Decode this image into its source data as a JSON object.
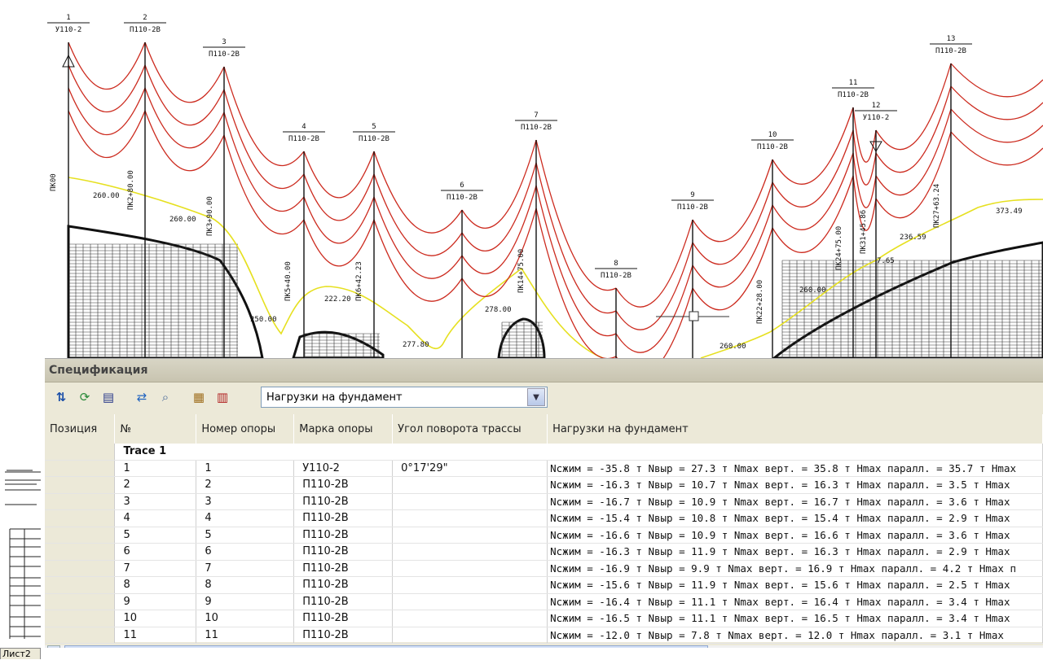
{
  "drawing": {
    "towers": [
      {
        "num": "1",
        "mark": "У110-2",
        "anchor": true
      },
      {
        "num": "2",
        "mark": "П110-2В"
      },
      {
        "num": "3",
        "mark": "П110-2В"
      },
      {
        "num": "4",
        "mark": "П110-2В"
      },
      {
        "num": "5",
        "mark": "П110-2В"
      },
      {
        "num": "6",
        "mark": "П110-2В"
      },
      {
        "num": "7",
        "mark": "П110-2В"
      },
      {
        "num": "8",
        "mark": "П110-2В"
      },
      {
        "num": "9",
        "mark": "П110-2В"
      },
      {
        "num": "10",
        "mark": "П110-2В"
      },
      {
        "num": "11",
        "mark": "П110-2В"
      },
      {
        "num": "12",
        "mark": "У110-2",
        "anchor": true
      },
      {
        "num": "13",
        "mark": "П110-2В"
      }
    ],
    "elevations": [
      "260.00",
      "260.00",
      "250.00",
      "222.20",
      "277.80",
      "278.00",
      "260.00",
      "260.00",
      "236.59",
      "373.49",
      "7.65"
    ],
    "pickets": [
      "ПК00",
      "ПК2+80.00",
      "ПК3+90.00",
      "ПК5+40.00",
      "ПК6+42.23",
      "ПК14+75.00",
      "ПК22+28.00",
      "ПК24+75.00",
      "ПК31+45.86",
      "ПК27+63.24"
    ]
  },
  "panel": {
    "title": "Спецификация",
    "filter_value": "Нагрузки на фундамент",
    "columns": [
      "Позиция",
      "№",
      "Номер опоры",
      "Марка опоры",
      "Угол поворота трассы",
      "Нагрузки на фундамент"
    ],
    "group_label": "Trace 1",
    "rows": [
      {
        "no": "1",
        "tower": "1",
        "mark": "У110-2",
        "angle": "0°17'29\"",
        "load": "Nсжим = -35.8 т Nвыр = 27.3 т Nmax верт. = 35.8 т Hmax паралл. = 35.7 т Hmax"
      },
      {
        "no": "2",
        "tower": "2",
        "mark": "П110-2В",
        "angle": "",
        "load": "Nсжим = -16.3 т Nвыр = 10.7 т Nmax верт. = 16.3 т Hmax паралл. = 3.5 т Hmax"
      },
      {
        "no": "3",
        "tower": "3",
        "mark": "П110-2В",
        "angle": "",
        "load": "Nсжим = -16.7 т Nвыр = 10.9 т Nmax верт. = 16.7 т Hmax паралл. = 3.6 т Hmax"
      },
      {
        "no": "4",
        "tower": "4",
        "mark": "П110-2В",
        "angle": "",
        "load": "Nсжим = -15.4 т Nвыр = 10.8 т Nmax верт. = 15.4 т Hmax паралл. = 2.9 т Hmax"
      },
      {
        "no": "5",
        "tower": "5",
        "mark": "П110-2В",
        "angle": "",
        "load": "Nсжим = -16.6 т Nвыр = 10.9 т Nmax верт. = 16.6 т Hmax паралл. = 3.6 т Hmax"
      },
      {
        "no": "6",
        "tower": "6",
        "mark": "П110-2В",
        "angle": "",
        "load": "Nсжим = -16.3 т Nвыр = 11.9 т Nmax верт. = 16.3 т Hmax паралл. = 2.9 т Hmax"
      },
      {
        "no": "7",
        "tower": "7",
        "mark": "П110-2В",
        "angle": "",
        "load": "Nсжим = -16.9 т Nвыр = 9.9 т Nmax верт. = 16.9 т Hmax паралл. = 4.2 т Hmax п"
      },
      {
        "no": "8",
        "tower": "8",
        "mark": "П110-2В",
        "angle": "",
        "load": "Nсжим = -15.6 т Nвыр = 11.9 т Nmax верт. = 15.6 т Hmax паралл. = 2.5 т Hmax"
      },
      {
        "no": "9",
        "tower": "9",
        "mark": "П110-2В",
        "angle": "",
        "load": "Nсжим = -16.4 т Nвыр = 11.1 т Nmax верт. = 16.4 т Hmax паралл. = 3.4 т Hmax"
      },
      {
        "no": "10",
        "tower": "10",
        "mark": "П110-2В",
        "angle": "",
        "load": "Nсжим = -16.5 т Nвыр = 11.1 т Nmax верт. = 16.5 т Hmax паралл. = 3.4 т Hmax"
      },
      {
        "no": "11",
        "tower": "11",
        "mark": "П110-2В",
        "angle": "",
        "load": "Nсжим = -12.0 т Nвыр = 7.8 т Nmax верт. = 12.0 т Hmax паралл. = 3.1 т Hmax"
      }
    ]
  },
  "sheet_tab": "Лист2",
  "colors": {
    "conductor": "#cc2a1e",
    "ground_line": "#e6e020",
    "terrain": "#111111",
    "panel_bg": "#ece9d8"
  }
}
